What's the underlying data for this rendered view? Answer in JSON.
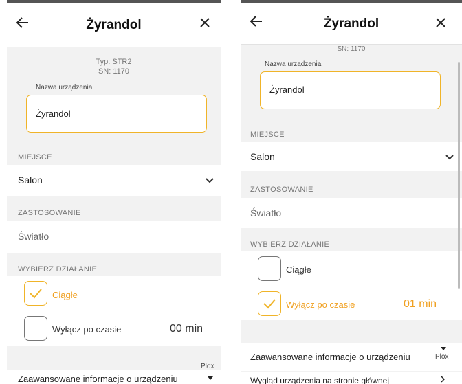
{
  "colors": {
    "accent": "#f0b429",
    "accent_text": "#f0a020",
    "muted": "#777777"
  },
  "left": {
    "title": "Żyrandol",
    "type_line": "Typ: STR2",
    "sn_line": "SN: 1170",
    "name_label": "Nazwa urządzenia",
    "name_value": "Żyrandol",
    "place_label": "MIEJSCE",
    "place_value": "Salon",
    "usage_label": "ZASTOSOWANIE",
    "usage_value": "Światło",
    "action_label": "WYBIERZ DZIAŁANIE",
    "option1": {
      "label": "Ciągłe",
      "checked": true
    },
    "option2": {
      "label": "Wyłącz po czasie",
      "checked": false,
      "time": "00 min"
    },
    "advanced": "Zaawansowane informacje o urządzeniu",
    "plox": "Plox"
  },
  "right": {
    "title": "Żyrandol",
    "sn_line": "SN: 1170",
    "name_label": "Nazwa urządzenia",
    "name_value": "Żyrandol",
    "place_label": "MIEJSCE",
    "place_value": "Salon",
    "usage_label": "ZASTOSOWANIE",
    "usage_value": "Światło",
    "action_label": "WYBIERZ DZIAŁANIE",
    "option1": {
      "label": "Ciągłe",
      "checked": false
    },
    "option2": {
      "label": "Wyłącz po czasie",
      "checked": true,
      "time": "01 min"
    },
    "advanced": "Zaawansowane informacje o urządzeniu",
    "plox": "Plox",
    "main_view": "Wygląd urządzenia na stronie głównej"
  }
}
